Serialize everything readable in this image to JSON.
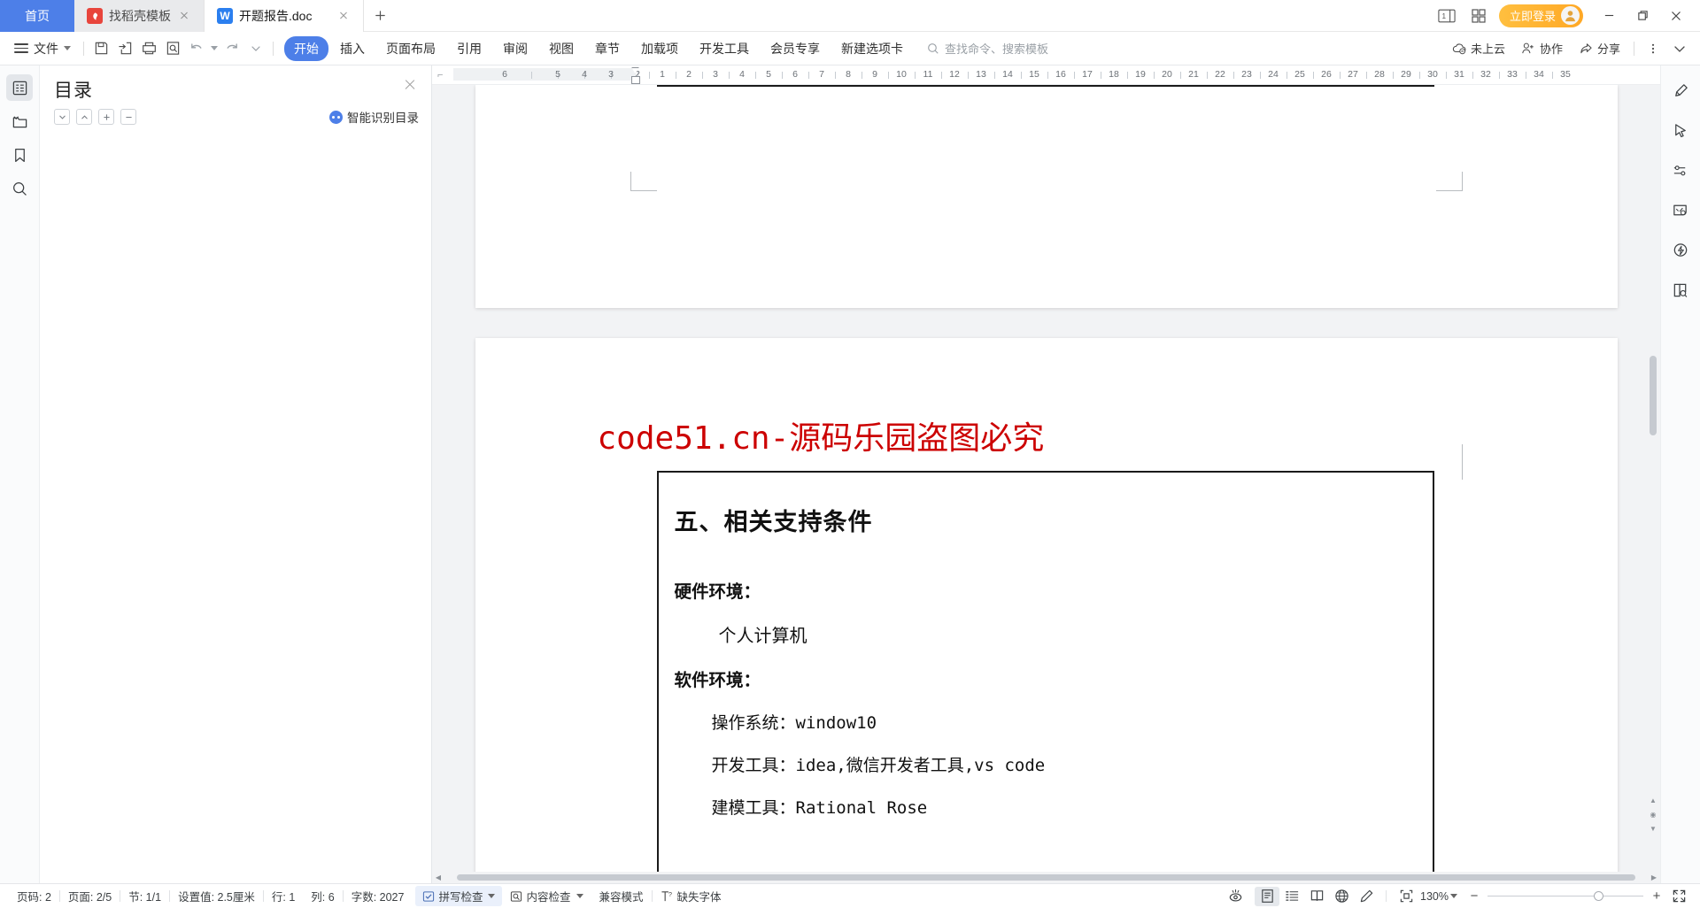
{
  "window": {
    "tabs": [
      {
        "label": "首页",
        "icon": "home",
        "type": "home"
      },
      {
        "label": "找稻壳模板",
        "icon": "docer-icon",
        "type": "inactive"
      },
      {
        "label": "开题报告.doc",
        "icon": "wps-writer-icon",
        "type": "active"
      }
    ],
    "new_tab_label": "+",
    "login_label": "立即登录",
    "controls": {
      "minimize": "—",
      "maximize": "❐",
      "close": "✕"
    }
  },
  "ribbon": {
    "file_menu": "文件",
    "tabs": [
      {
        "label": "开始",
        "selected": true
      },
      {
        "label": "插入",
        "selected": false
      },
      {
        "label": "页面布局",
        "selected": false
      },
      {
        "label": "引用",
        "selected": false
      },
      {
        "label": "审阅",
        "selected": false
      },
      {
        "label": "视图",
        "selected": false
      },
      {
        "label": "章节",
        "selected": false
      },
      {
        "label": "加载项",
        "selected": false
      },
      {
        "label": "开发工具",
        "selected": false
      },
      {
        "label": "会员专享",
        "selected": false
      },
      {
        "label": "新建选项卡",
        "selected": false
      }
    ],
    "search_placeholder": "查找命令、搜索模板",
    "right_actions": [
      {
        "label": "未上云",
        "icon": "cloud-off-icon"
      },
      {
        "label": "协作",
        "icon": "collaborate-icon"
      },
      {
        "label": "分享",
        "icon": "share-icon"
      }
    ],
    "quick_access": [
      "save-icon",
      "export-pdf-icon",
      "print-icon",
      "print-preview-icon",
      "undo-icon",
      "redo-icon",
      "more-icon"
    ]
  },
  "left_rail": [
    {
      "name": "outline",
      "icon": "outline-icon",
      "active": true
    },
    {
      "name": "files",
      "icon": "folder-icon",
      "active": false
    },
    {
      "name": "bookmark",
      "icon": "bookmark-icon",
      "active": false
    },
    {
      "name": "search",
      "icon": "search-icon",
      "active": false
    }
  ],
  "right_rail": [
    {
      "name": "pen",
      "icon": "pen-icon"
    },
    {
      "name": "select",
      "icon": "cursor-icon"
    },
    {
      "name": "adjust",
      "icon": "sliders-icon"
    },
    {
      "name": "picture-ai",
      "icon": "image-ai-icon"
    },
    {
      "name": "ai-assistant",
      "icon": "lightning-icon"
    },
    {
      "name": "reading",
      "icon": "book-search-icon"
    }
  ],
  "outline_panel": {
    "title": "目录",
    "tools": [
      "chevron-down",
      "chevron-up",
      "plus",
      "minus"
    ],
    "smart_toc_label": "智能识别目录",
    "items": []
  },
  "ruler": {
    "left_ticks": [
      "6",
      "5",
      "4",
      "3",
      "2",
      "1"
    ],
    "right_ticks": [
      "1",
      "2",
      "3",
      "4",
      "5",
      "6",
      "7",
      "8",
      "9",
      "10",
      "11",
      "12",
      "13",
      "14",
      "15",
      "16",
      "17",
      "18",
      "19",
      "20",
      "21",
      "22",
      "23",
      "24",
      "25",
      "26",
      "27",
      "28",
      "29",
      "30",
      "31",
      "32",
      "33",
      "34",
      "35"
    ]
  },
  "document": {
    "watermark": "code51.cn-源码乐园盗图必究",
    "heading": "五、相关支持条件",
    "blocks": [
      {
        "type": "bold",
        "text": "硬件环境："
      },
      {
        "type": "indent",
        "text": "个人计算机"
      },
      {
        "type": "bold",
        "text": "软件环境："
      },
      {
        "type": "indent-mono",
        "text": "操作系统：window10"
      },
      {
        "type": "indent-mono",
        "text": "开发工具：idea,微信开发者工具,vs code"
      },
      {
        "type": "indent-mono",
        "text": "建模工具：Rational Rose"
      }
    ]
  },
  "status_bar": {
    "page_no": "页码: 2",
    "page_of": "页面: 2/5",
    "section": "节: 1/1",
    "setting": "设置值: 2.5厘米",
    "row": "行: 1",
    "col": "列: 6",
    "word_count": "字数: 2027",
    "spell_check": "拼写检查",
    "content_check": "内容检查",
    "compat_mode": "兼容模式",
    "missing_font": "缺失字体",
    "zoom_level": "130%",
    "view_modes": [
      "page-view",
      "outline-view",
      "reading-view",
      "web-view",
      "edit-view"
    ],
    "zoom_out": "−",
    "zoom_in": "+"
  },
  "colors": {
    "accent_blue": "#4d7fe8",
    "login_orange": "#ffa825",
    "watermark_red": "#cc0000",
    "docer_red": "#e8453c"
  }
}
